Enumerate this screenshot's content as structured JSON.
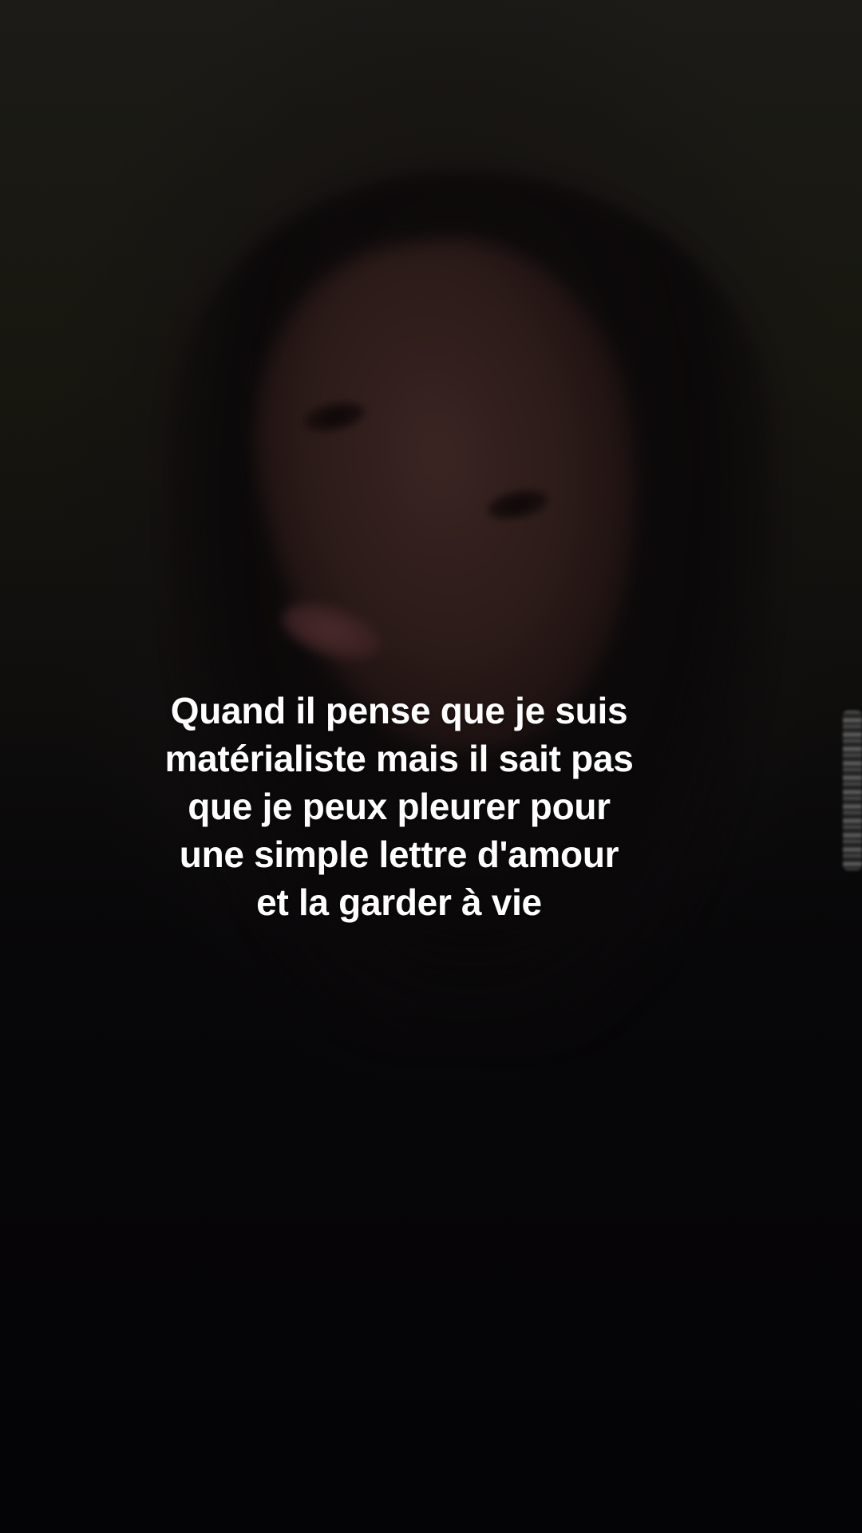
{
  "caption": {
    "lines": [
      "Quand il pense que je suis",
      "matérialiste mais il sait pas",
      "que je peux pleurer pour",
      "une simple lettre d'amour",
      "et la garder à vie"
    ]
  }
}
